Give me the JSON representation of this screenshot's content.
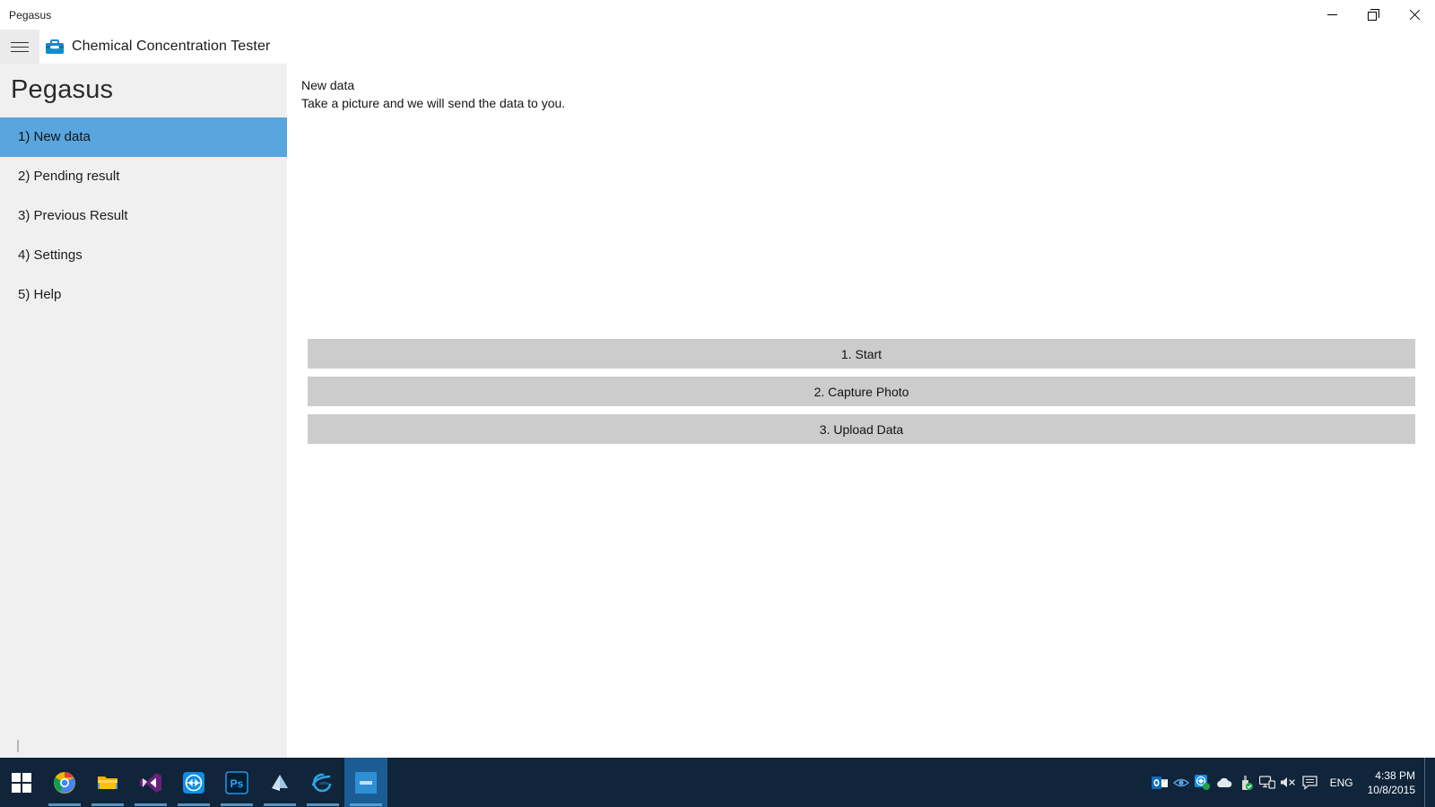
{
  "window": {
    "title": "Pegasus",
    "controls": {
      "minimize": "minimize-button",
      "maximize": "restore-button",
      "close": "close-button"
    }
  },
  "app_header": {
    "menu_icon": "hamburger-menu-icon",
    "app_icon": "toolbox-icon",
    "title": "Chemical Concentration Tester"
  },
  "sidebar": {
    "title": "Pegasus",
    "items": [
      {
        "label": "1) New data",
        "selected": true
      },
      {
        "label": "2) Pending result",
        "selected": false
      },
      {
        "label": "3) Previous Result",
        "selected": false
      },
      {
        "label": "4) Settings",
        "selected": false
      },
      {
        "label": "5) Help",
        "selected": false
      }
    ],
    "selected_color": "#58a6dd",
    "background_color": "#f0f0f0"
  },
  "main": {
    "title": "New data",
    "subtitle": "Take a picture and we will send the data to you.",
    "buttons": [
      {
        "label": "1. Start"
      },
      {
        "label": "2. Capture Photo"
      },
      {
        "label": "3. Upload Data"
      }
    ],
    "button_color": "#cccccc"
  },
  "taskbar": {
    "background_color": "#10243a",
    "start_button": "windows-start-icon",
    "tasks": [
      {
        "name": "chrome",
        "label": "Google Chrome",
        "running": true,
        "active": false
      },
      {
        "name": "file-explorer",
        "label": "File Explorer",
        "running": true,
        "active": false
      },
      {
        "name": "visual-studio",
        "label": "Visual Studio",
        "running": true,
        "active": false
      },
      {
        "name": "teamviewer",
        "label": "TeamViewer",
        "running": true,
        "active": false
      },
      {
        "name": "photoshop",
        "label": "Adobe Photoshop",
        "running": true,
        "active": false
      },
      {
        "name": "onenote",
        "label": "OneNote",
        "running": true,
        "active": false
      },
      {
        "name": "internet-explorer",
        "label": "Internet Explorer",
        "running": true,
        "active": false
      },
      {
        "name": "pegasus",
        "label": "Pegasus",
        "running": true,
        "active": true
      }
    ],
    "tray": [
      {
        "name": "outlook-icon",
        "label": "Outlook"
      },
      {
        "name": "eye-icon",
        "label": "Eye"
      },
      {
        "name": "teamviewer-tray-icon",
        "label": "TeamViewer"
      },
      {
        "name": "onedrive-icon",
        "label": "OneDrive"
      },
      {
        "name": "usb-safe-removal-icon",
        "label": "Safely Remove Hardware"
      },
      {
        "name": "network-icon",
        "label": "Network"
      },
      {
        "name": "volume-muted-icon",
        "label": "Volume muted"
      },
      {
        "name": "action-center-icon",
        "label": "Action Center"
      }
    ],
    "language": "ENG",
    "time": "4:38 PM",
    "date": "10/8/2015"
  }
}
